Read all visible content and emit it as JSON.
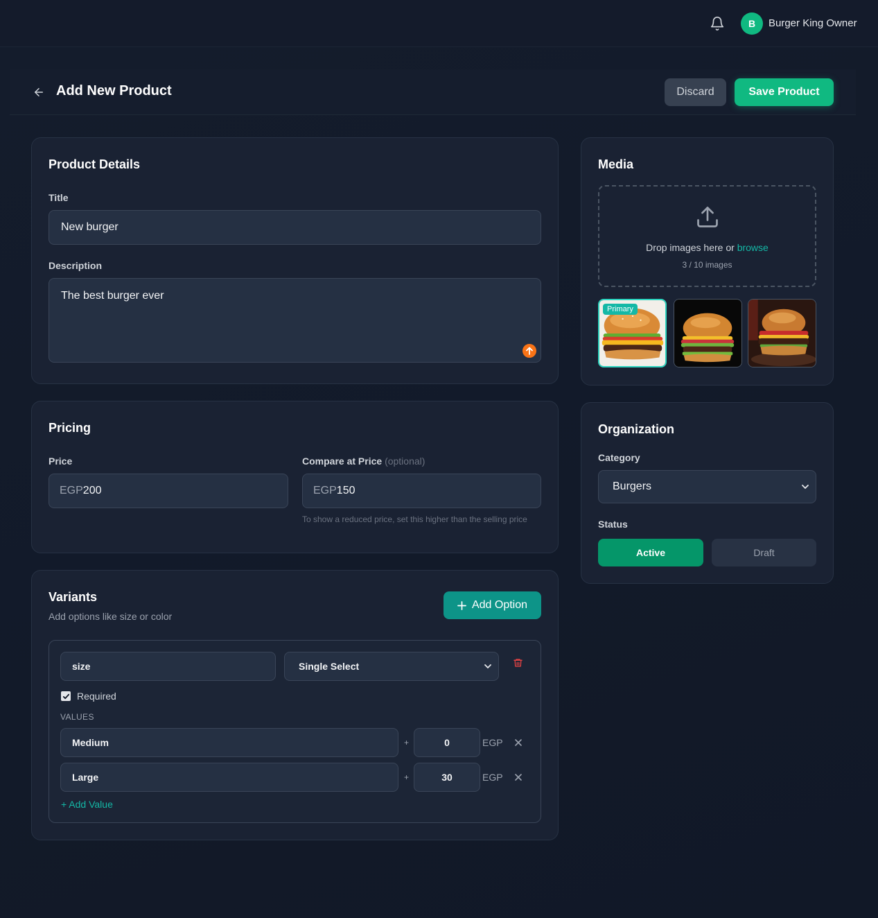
{
  "topbar": {
    "user_initial": "B",
    "user_name": "Burger King Owner"
  },
  "header": {
    "title": "Add New Product",
    "discard_label": "Discard",
    "save_label": "Save Product"
  },
  "product_details": {
    "heading": "Product Details",
    "title_label": "Title",
    "title_value": "New burger",
    "description_label": "Description",
    "description_value": "The best burger ever"
  },
  "pricing": {
    "heading": "Pricing",
    "price_label": "Price",
    "currency": "EGP",
    "price_value": "200",
    "compare_label": "Compare at Price",
    "compare_optional": "(optional)",
    "compare_value": "150",
    "compare_hint": "To show a reduced price, set this higher than the selling price"
  },
  "variants": {
    "heading": "Variants",
    "subtitle": "Add options like size or color",
    "add_option_label": "Add Option",
    "option": {
      "name": "size",
      "type": "Single Select",
      "required_label": "Required",
      "required_checked": true,
      "values_heading": "VALUES",
      "values": [
        {
          "name": "Medium",
          "price": "0",
          "currency": "EGP"
        },
        {
          "name": "Large",
          "price": "30",
          "currency": "EGP"
        }
      ],
      "add_value_label": "+ Add Value"
    }
  },
  "media": {
    "heading": "Media",
    "drop_text": "Drop images here or",
    "browse_link": "browse",
    "count_text": "3 / 10 images",
    "primary_badge": "Primary",
    "images": [
      "burger-image-1",
      "burger-image-2",
      "burger-image-3"
    ]
  },
  "organization": {
    "heading": "Organization",
    "category_label": "Category",
    "category_value": "Burgers",
    "status_label": "Status",
    "status_active": "Active",
    "status_draft": "Draft"
  },
  "colors": {
    "accent": "#10b981",
    "accent_teal": "#0d9488",
    "background": "#111827",
    "card": "#1a2233",
    "field": "#253043",
    "danger": "#ef4444",
    "orange_indicator": "#f97316"
  },
  "icons": [
    "bell-icon",
    "back-arrow-icon",
    "upload-icon",
    "plus-icon",
    "trash-icon",
    "close-icon",
    "chevron-down-icon",
    "check-icon",
    "arrow-up-icon"
  ]
}
